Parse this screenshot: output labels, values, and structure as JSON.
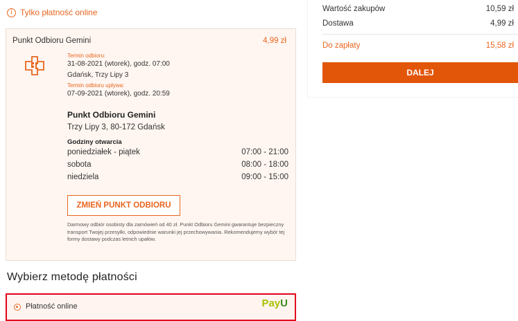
{
  "notice": {
    "icon": "info-icon",
    "text": "Tylko płatność online"
  },
  "pickup": {
    "name": "Punkt Odbioru Gemini",
    "price": "4,99 zł",
    "pickup_date_label": "Termin odbioru:",
    "pickup_date": "31-08-2021 (wtorek), godz. 07:00",
    "city_street": "Gdańsk, Trzy Lipy 3",
    "expiry_label": "Termin odbioru upływa:",
    "expiry_date": "07-09-2021 (wtorek), godz. 20:59",
    "point_title": "Punkt Odbioru Gemini",
    "point_address": "Trzy Lipy 3, 80-172 Gdańsk",
    "hours_title": "Godziny otwarcia",
    "hours": [
      {
        "day": "poniedziałek - piątek",
        "time": "07:00 - 21:00"
      },
      {
        "day": "sobota",
        "time": "08:00 - 18:00"
      },
      {
        "day": "niedziela",
        "time": "09:00 - 15:00"
      }
    ],
    "change_button": "ZMIEŃ PUNKT ODBIORU",
    "disclaimer": "Darmowy odbiór osobisty dla zamówień od 40 zł. Punkt Odbioru Gemini gwarantuje bezpieczny transport Twojej przesyłki, odpowiednie warunki jej przechowywania. Rekomendujemy wybór tej formy dostawy podczas letnich upałów."
  },
  "payment": {
    "section_title": "Wybierz metodę płatności",
    "option_label": "Płatność online",
    "option_selected": true,
    "provider_logo": "PayU"
  },
  "summary": {
    "rows": [
      {
        "label": "Wartość zakupów",
        "value": "10,59 zł"
      },
      {
        "label": "Dostawa",
        "value": "4,99 zł"
      }
    ],
    "total_label": "Do zapłaty",
    "total_value": "15,58 zł",
    "next_button": "DALEJ"
  },
  "colors": {
    "accent": "#e8661f",
    "button": "#e2560a",
    "highlight_border": "#e2001a",
    "payu_green": "#a6c307"
  }
}
